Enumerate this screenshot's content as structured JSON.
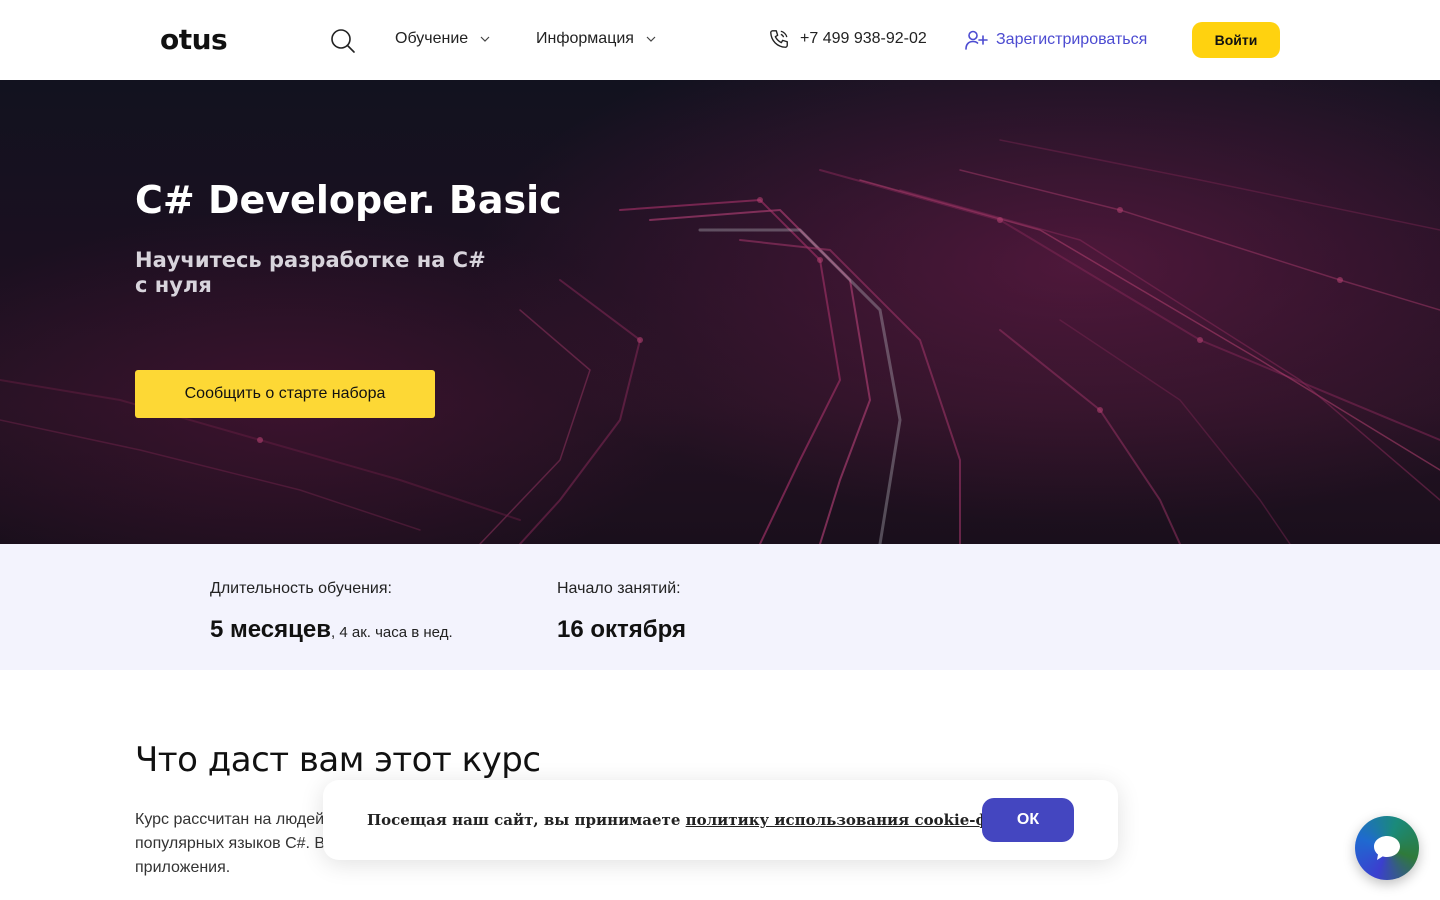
{
  "header": {
    "logo_text": "otus",
    "nav": [
      {
        "label": "Обучение"
      },
      {
        "label": "Информация"
      }
    ],
    "phone": "+7 499 938-92-02",
    "register_label": "Зарегистрироваться",
    "login_label": "Войти"
  },
  "hero": {
    "title": "C# Developer. Basic",
    "subtitle": "Научитесь разработке на C# с нуля",
    "cta_label": "Сообщить о старте набора"
  },
  "info": {
    "duration_label": "Длительность обучения:",
    "duration_value": "5 месяцев",
    "duration_detail": ", 4 ак. часа в нед.",
    "start_label": "Начало занятий:",
    "start_value": "16 октября"
  },
  "course": {
    "title": "Что даст вам этот курс",
    "text_line1": "Курс рассчитан на людей",
    "text_line2": "популярных языков C#. В",
    "text_line3": "приложения."
  },
  "cookie": {
    "text": "Посещая наш сайт, вы принимаете ",
    "link": "политику использования cookie-файлов",
    "ok_label": "ОК"
  },
  "colors": {
    "accent_yellow": "#ffd20f",
    "accent_blue": "#4446c0",
    "register_blue": "#4c4bd1",
    "info_bg": "#f3f3fd"
  },
  "icons": [
    "search-icon",
    "chevron-down-icon",
    "phone-icon",
    "user-plus-icon",
    "chat-icon"
  ]
}
